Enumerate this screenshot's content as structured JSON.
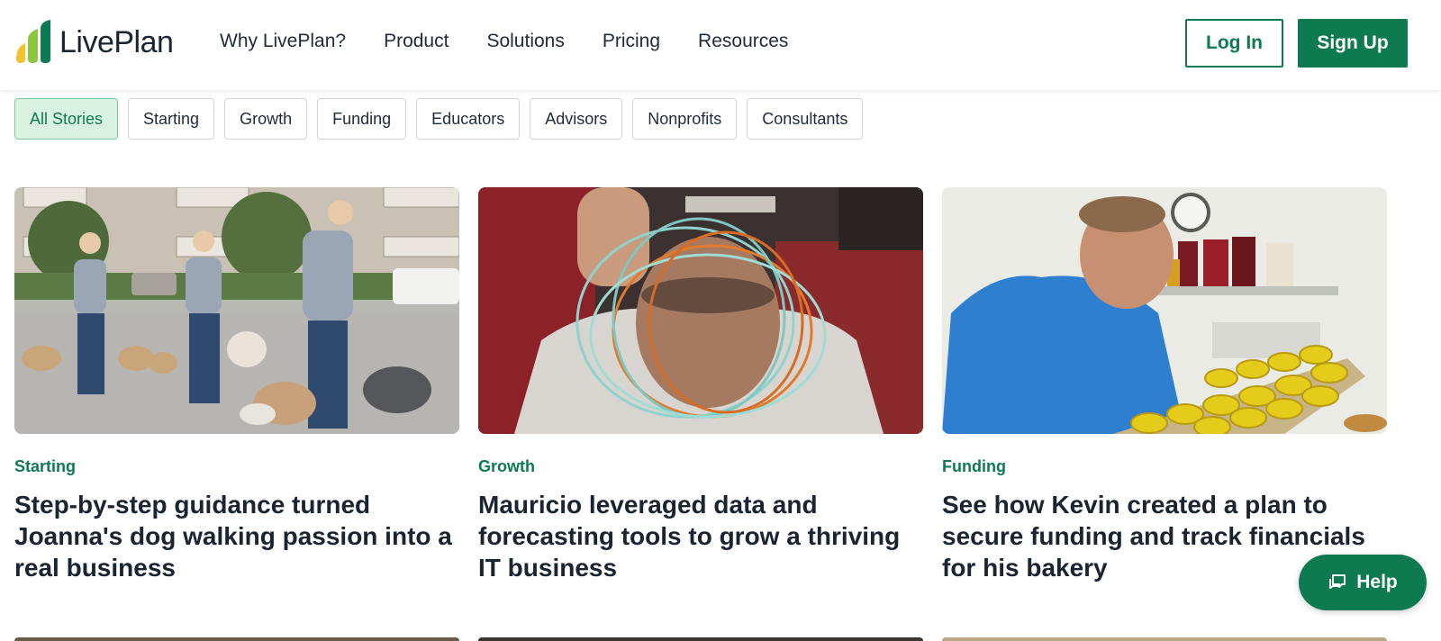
{
  "brand": {
    "name": "LivePlan",
    "colors": {
      "green": "#0e7a4f",
      "yellow": "#f2c12e",
      "lime": "#8cc63f"
    }
  },
  "nav": {
    "items": [
      "Why LivePlan?",
      "Product",
      "Solutions",
      "Pricing",
      "Resources"
    ],
    "login_label": "Log In",
    "signup_label": "Sign Up"
  },
  "filters": {
    "items": [
      "All Stories",
      "Starting",
      "Growth",
      "Funding",
      "Educators",
      "Advisors",
      "Nonprofits",
      "Consultants"
    ],
    "active": "All Stories"
  },
  "stories": [
    {
      "category": "Starting",
      "title": "Step-by-step guidance turned Joanna's dog walking passion into a real business"
    },
    {
      "category": "Growth",
      "title": "Mauricio leveraged data and forecasting tools to grow a thriving IT business"
    },
    {
      "category": "Funding",
      "title": "See how Kevin created a plan to secure funding and track financials for his bakery"
    }
  ],
  "help": {
    "label": "Help",
    "icon": "chat-icon"
  }
}
